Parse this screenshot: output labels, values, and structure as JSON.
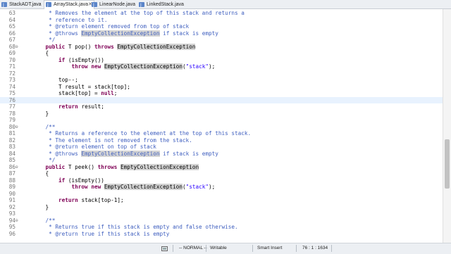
{
  "tabs": [
    {
      "label": "StackADT.java",
      "active": false
    },
    {
      "label": "ArrayStack.java",
      "active": true
    },
    {
      "label": "LinearNode.java",
      "active": false
    },
    {
      "label": "LinkedStack.java",
      "active": false
    }
  ],
  "editor": {
    "current_line": 76,
    "lines": [
      {
        "n": "63",
        "fold": "",
        "indent": "     ",
        "segs": [
          {
            "t": "* Removes the element at the top of this stack and returns a",
            "c": "cm"
          }
        ]
      },
      {
        "n": "64",
        "fold": "",
        "indent": "     ",
        "segs": [
          {
            "t": "* reference to it.",
            "c": "cm"
          }
        ]
      },
      {
        "n": "65",
        "fold": "",
        "indent": "     ",
        "segs": [
          {
            "t": "* @return element removed from top of stack",
            "c": "cm"
          }
        ]
      },
      {
        "n": "66",
        "fold": "",
        "indent": "     ",
        "segs": [
          {
            "t": "* @throws ",
            "c": "cm"
          },
          {
            "t": "EmptyCollectionException",
            "c": "cm hl"
          },
          {
            "t": " if stack is empty",
            "c": "cm"
          }
        ]
      },
      {
        "n": "67",
        "fold": "",
        "indent": "     ",
        "segs": [
          {
            "t": "*/",
            "c": "cm"
          }
        ]
      },
      {
        "n": "68",
        "fold": "⊖",
        "indent": "    ",
        "segs": [
          {
            "t": "public",
            "c": "kw"
          },
          {
            "t": " T pop() ",
            "c": ""
          },
          {
            "t": "throws",
            "c": "kw"
          },
          {
            "t": " ",
            "c": ""
          },
          {
            "t": "EmptyCollectionException",
            "c": "hl"
          }
        ]
      },
      {
        "n": "69",
        "fold": "",
        "indent": "    ",
        "segs": [
          {
            "t": "{",
            "c": ""
          }
        ]
      },
      {
        "n": "70",
        "fold": "",
        "indent": "        ",
        "segs": [
          {
            "t": "if",
            "c": "kw"
          },
          {
            "t": " (isEmpty())",
            "c": ""
          }
        ]
      },
      {
        "n": "71",
        "fold": "",
        "indent": "            ",
        "segs": [
          {
            "t": "throw",
            "c": "kw"
          },
          {
            "t": " ",
            "c": ""
          },
          {
            "t": "new",
            "c": "kw"
          },
          {
            "t": " ",
            "c": ""
          },
          {
            "t": "EmptyCollectionException",
            "c": "hl"
          },
          {
            "t": "(",
            "c": ""
          },
          {
            "t": "\"stack\"",
            "c": "str"
          },
          {
            "t": ");",
            "c": ""
          }
        ]
      },
      {
        "n": "72",
        "fold": "",
        "indent": "",
        "segs": []
      },
      {
        "n": "73",
        "fold": "",
        "indent": "        ",
        "segs": [
          {
            "t": "top--;",
            "c": ""
          }
        ]
      },
      {
        "n": "74",
        "fold": "",
        "indent": "        ",
        "segs": [
          {
            "t": "T result = stack[top];",
            "c": ""
          }
        ]
      },
      {
        "n": "75",
        "fold": "",
        "indent": "        ",
        "segs": [
          {
            "t": "stack[top] = ",
            "c": ""
          },
          {
            "t": "null",
            "c": "kw"
          },
          {
            "t": ";",
            "c": ""
          }
        ]
      },
      {
        "n": "76",
        "fold": "",
        "indent": "",
        "segs": []
      },
      {
        "n": "77",
        "fold": "",
        "indent": "        ",
        "segs": [
          {
            "t": "return",
            "c": "kw"
          },
          {
            "t": " result;",
            "c": ""
          }
        ]
      },
      {
        "n": "78",
        "fold": "",
        "indent": "    ",
        "segs": [
          {
            "t": "}",
            "c": ""
          }
        ]
      },
      {
        "n": "79",
        "fold": "",
        "indent": "",
        "segs": []
      },
      {
        "n": "80",
        "fold": "⊖",
        "indent": "    ",
        "segs": [
          {
            "t": "/**",
            "c": "cm"
          }
        ]
      },
      {
        "n": "81",
        "fold": "",
        "indent": "     ",
        "segs": [
          {
            "t": "* Returns a reference to the element at the top of this stack.",
            "c": "cm"
          }
        ]
      },
      {
        "n": "82",
        "fold": "",
        "indent": "     ",
        "segs": [
          {
            "t": "* The element is not removed from the stack.",
            "c": "cm"
          }
        ]
      },
      {
        "n": "83",
        "fold": "",
        "indent": "     ",
        "segs": [
          {
            "t": "* @return element on top of stack",
            "c": "cm"
          }
        ]
      },
      {
        "n": "84",
        "fold": "",
        "indent": "     ",
        "segs": [
          {
            "t": "* @throws ",
            "c": "cm"
          },
          {
            "t": "EmptyCollectionException",
            "c": "cm hl"
          },
          {
            "t": " if stack is empty",
            "c": "cm"
          }
        ]
      },
      {
        "n": "85",
        "fold": "",
        "indent": "     ",
        "segs": [
          {
            "t": "*/",
            "c": "cm"
          }
        ]
      },
      {
        "n": "86",
        "fold": "⊖",
        "indent": "    ",
        "segs": [
          {
            "t": "public",
            "c": "kw"
          },
          {
            "t": " T peek() ",
            "c": ""
          },
          {
            "t": "throws",
            "c": "kw"
          },
          {
            "t": " ",
            "c": ""
          },
          {
            "t": "EmptyCollectionException",
            "c": "hl"
          }
        ]
      },
      {
        "n": "87",
        "fold": "",
        "indent": "    ",
        "segs": [
          {
            "t": "{",
            "c": ""
          }
        ]
      },
      {
        "n": "88",
        "fold": "",
        "indent": "        ",
        "segs": [
          {
            "t": "if",
            "c": "kw"
          },
          {
            "t": " (isEmpty())",
            "c": ""
          }
        ]
      },
      {
        "n": "89",
        "fold": "",
        "indent": "            ",
        "segs": [
          {
            "t": "throw",
            "c": "kw"
          },
          {
            "t": " ",
            "c": ""
          },
          {
            "t": "new",
            "c": "kw"
          },
          {
            "t": " ",
            "c": ""
          },
          {
            "t": "EmptyCollectionException",
            "c": "hl"
          },
          {
            "t": "(",
            "c": ""
          },
          {
            "t": "\"stack\"",
            "c": "str"
          },
          {
            "t": ");",
            "c": ""
          }
        ]
      },
      {
        "n": "90",
        "fold": "",
        "indent": "",
        "segs": []
      },
      {
        "n": "91",
        "fold": "",
        "indent": "        ",
        "segs": [
          {
            "t": "return",
            "c": "kw"
          },
          {
            "t": " stack[top-1];",
            "c": ""
          }
        ]
      },
      {
        "n": "92",
        "fold": "",
        "indent": "    ",
        "segs": [
          {
            "t": "}",
            "c": ""
          }
        ]
      },
      {
        "n": "93",
        "fold": "",
        "indent": "",
        "segs": []
      },
      {
        "n": "94",
        "fold": "⊖",
        "indent": "    ",
        "segs": [
          {
            "t": "/**",
            "c": "cm"
          }
        ]
      },
      {
        "n": "95",
        "fold": "",
        "indent": "     ",
        "segs": [
          {
            "t": "* Returns true if this stack is empty and false otherwise.",
            "c": "cm"
          }
        ]
      },
      {
        "n": "96",
        "fold": "",
        "indent": "     ",
        "segs": [
          {
            "t": "* @return true if this stack is empty",
            "c": "cm"
          }
        ]
      }
    ]
  },
  "status": {
    "mode": "-- NORMAL --",
    "writable": "Writable",
    "insert_mode": "Smart Insert",
    "position": "76 : 1 : 1634"
  },
  "colors": {
    "keyword": "#7f0055",
    "comment": "#3f5fbf",
    "string": "#2a00ff",
    "current_line": "#e8f2fe",
    "occurrence_highlight": "#d4d4d4"
  }
}
